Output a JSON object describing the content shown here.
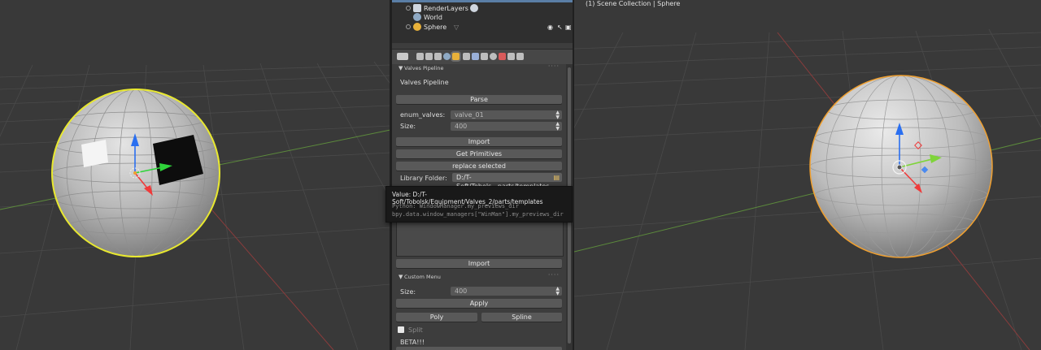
{
  "viewport_right": {
    "label": "(1) Scene Collection | Sphere"
  },
  "outliner": {
    "items": [
      {
        "label": "RenderLayers"
      },
      {
        "label": "World"
      },
      {
        "label": "Sphere"
      }
    ]
  },
  "panel": {
    "valves": {
      "header": "Valves Pipeline",
      "title": "Valves Pipeline",
      "parse": "Parse",
      "enum_label": "enum_valves:",
      "enum_value": "valve_01",
      "size_label": "Size:",
      "size_value": "400",
      "import": "Import",
      "get_primitives": "Get Primitives",
      "replace_selected": "replace selected",
      "library_label": "Library Folder:",
      "library_value": "D:/T-Soft/Tobols...parts/templates",
      "import2": "Import"
    },
    "tooltip": {
      "value": "Value: D:/T-Soft/Tobolsk/Equipment/Valves_2/parts/templates",
      "python1": "Python: WindowManager.my_previews_dir",
      "python2": "bpy.data.window_managers[\"WinMan\"].my_previews_dir"
    },
    "custom": {
      "header": "Custom Menu",
      "size_label": "Size:",
      "size_value": "400",
      "apply": "Apply",
      "poly": "Poly",
      "spline": "Spline",
      "split": "Split",
      "beta": "BETA!!!"
    }
  },
  "colors": {
    "accent": "#5a7ea6",
    "selected_outline": "#e8e830",
    "active_outline": "#f0a030"
  }
}
